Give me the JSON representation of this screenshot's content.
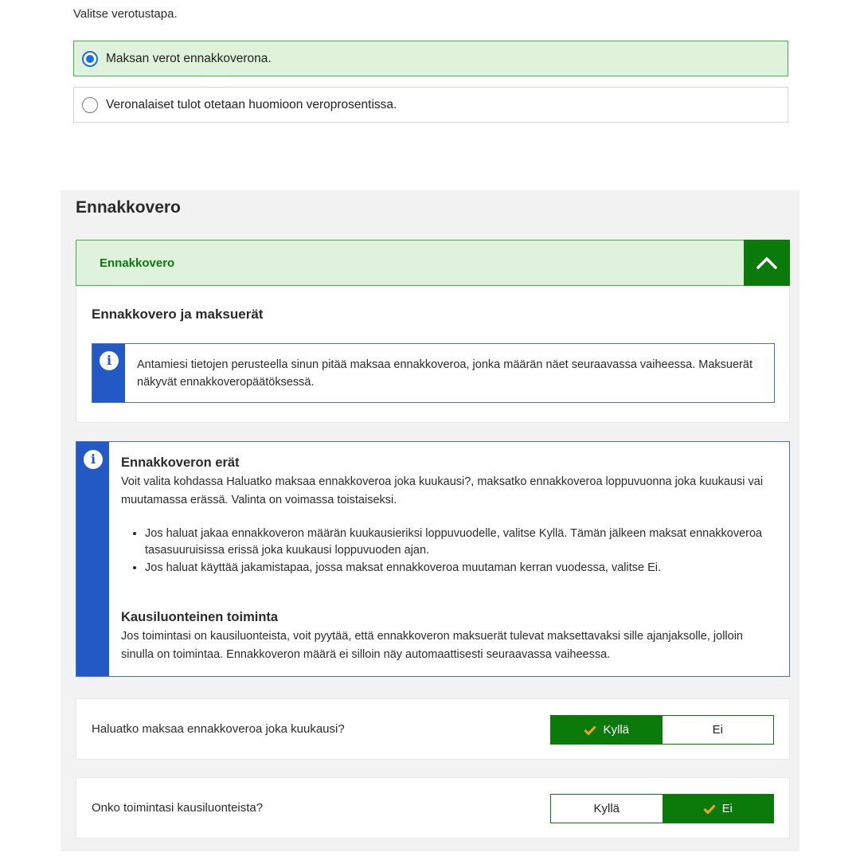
{
  "tax_method": {
    "prompt": "Valitse verotustapa.",
    "options": [
      {
        "label": "Maksan verot ennakkoverona.",
        "selected": true
      },
      {
        "label": "Veronalaiset tulot otetaan huomioon veroprosentissa.",
        "selected": false
      }
    ]
  },
  "section": {
    "title": "Ennakkovero",
    "accordion": {
      "label": "Ennakkovero",
      "expanded": true,
      "body_title": "Ennakkovero ja maksuerät",
      "info_text": "Antamiesi tietojen perusteella sinun pitää maksaa ennakkoveroa, jonka määrän näet seuraavassa vaiheessa. Maksuerät näkyvät ennakkoveropäätöksessä."
    },
    "info_box": {
      "heading1": "Ennakkoveron erät",
      "paragraph1": "Voit valita kohdassa Haluatko maksaa ennakkoveroa joka kuukausi?, maksatko ennakkoveroa loppuvuonna joka kuukausi vai muutamassa erässä. Valinta on voimassa toistaiseksi.",
      "bullets": [
        "Jos haluat jakaa ennakkoveron määrän kuukausieriksi loppuvuodelle, valitse Kyllä. Tämän jälkeen maksat ennakkoveroa tasasuuruisissa erissä joka kuukausi loppuvuoden ajan.",
        "Jos haluat käyttää jakamistapaa, jossa maksat ennakkoveroa muutaman kerran vuodessa, valitse Ei."
      ],
      "heading2": "Kausiluonteinen toiminta",
      "paragraph2": "Jos toimintasi on kausiluonteista, voit pyytää, että ennakkoveron maksuerät tulevat maksettavaksi sille ajanjaksolle, jolloin sinulla on toimintaa. Ennakkoveron määrä ei silloin näy automaattisesti seuraavassa vaiheessa."
    },
    "questions": [
      {
        "label": "Haluatko maksaa ennakkoveroa joka kuukausi?",
        "yes": "Kyllä",
        "no": "Ei",
        "selected": "yes"
      },
      {
        "label": "Onko toimintasi kausiluonteista?",
        "yes": "Kyllä",
        "no": "Ei",
        "selected": "no"
      }
    ]
  },
  "colors": {
    "accent_green": "#0a7a0a",
    "selected_bg": "#dff2dc",
    "info_blue": "#2359c4",
    "radio_blue": "#1a6fe0",
    "check_orange": "#f5a623"
  }
}
